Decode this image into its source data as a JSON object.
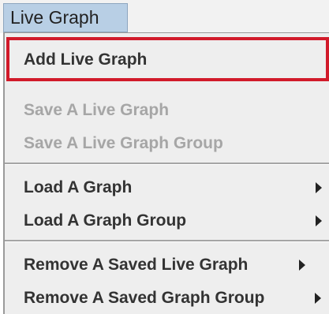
{
  "menu": {
    "title": "Live Graph"
  },
  "items": [
    {
      "label": "Add Live Graph",
      "enabled": true
    },
    {
      "label": "Save A Live Graph",
      "enabled": false
    },
    {
      "label": "Save A Live Graph Group",
      "enabled": false
    },
    {
      "label": "Load A Graph",
      "enabled": true,
      "submenu": true
    },
    {
      "label": "Load A Graph Group",
      "enabled": true,
      "submenu": true
    },
    {
      "label": "Remove A Saved Live Graph",
      "enabled": true,
      "submenu": true
    },
    {
      "label": "Remove A Saved Graph Group",
      "enabled": true,
      "submenu": true
    }
  ],
  "colors": {
    "highlight_border": "#d11a2a",
    "menu_title_bg": "#b8cfe5",
    "disabled_text": "#a6a6a6"
  }
}
